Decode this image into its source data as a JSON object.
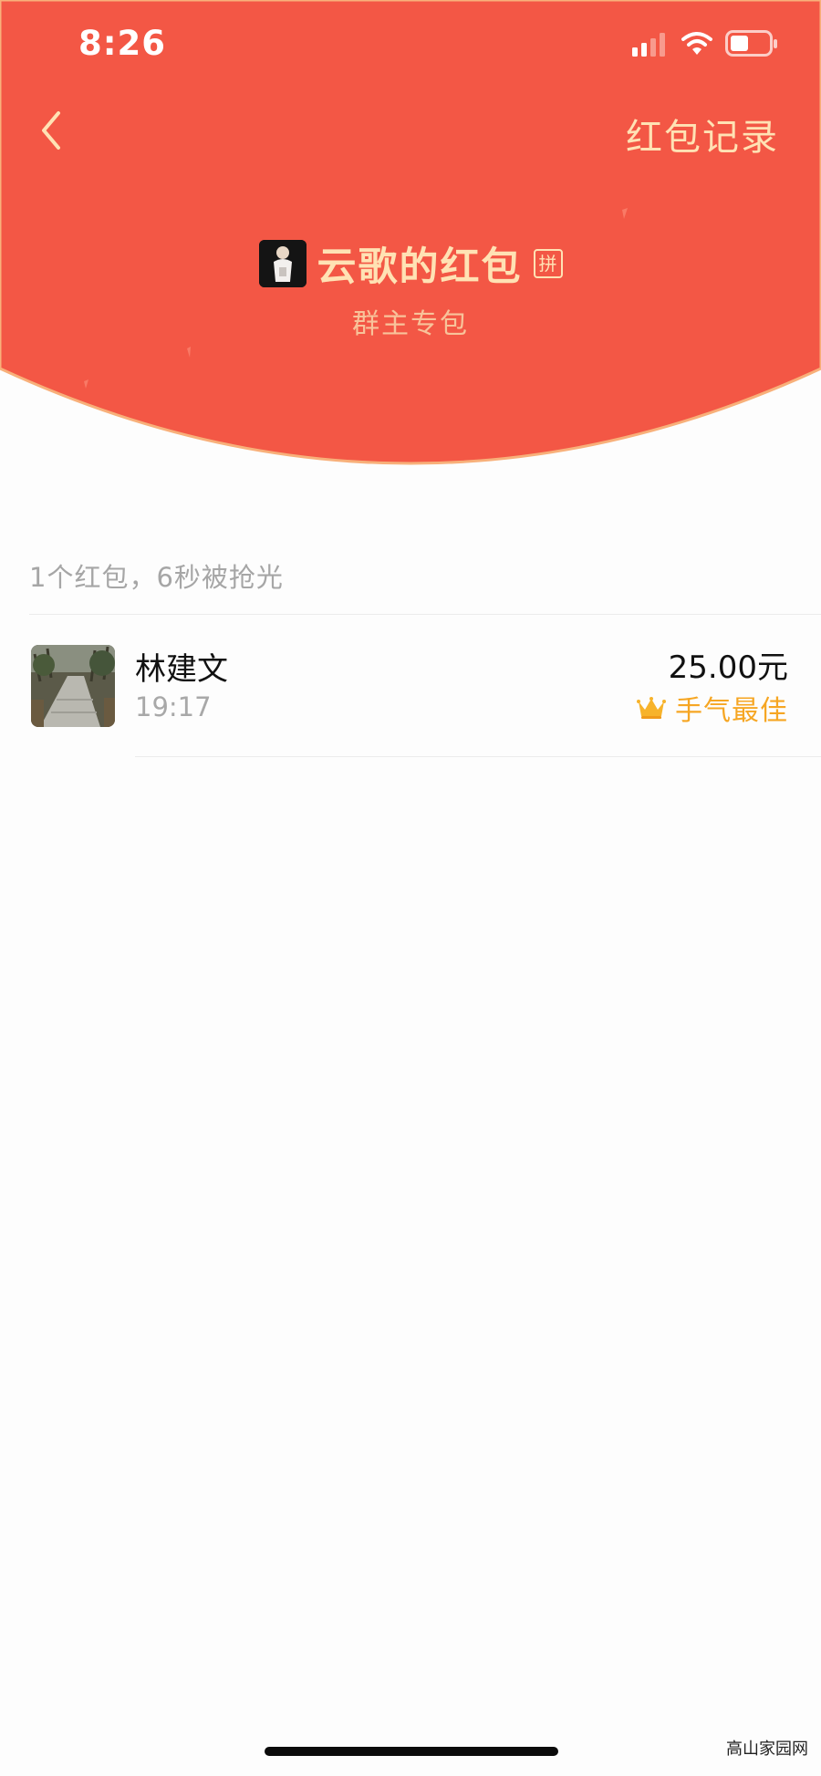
{
  "status_bar": {
    "time": "8:26"
  },
  "nav": {
    "records_label": "红包记录"
  },
  "sender": {
    "title": "云歌的红包",
    "badge": "拼",
    "subtitle": "群主专包"
  },
  "summary": "1个红包，6秒被抢光",
  "records": [
    {
      "name": "林建文",
      "time": "19:17",
      "amount": "25.00元",
      "best_label": "手气最佳"
    }
  ],
  "watermark": "高山家园网",
  "colors": {
    "header_red": "#f35745",
    "gold_text": "#ffe2b4",
    "best_orange": "#f6a623"
  }
}
